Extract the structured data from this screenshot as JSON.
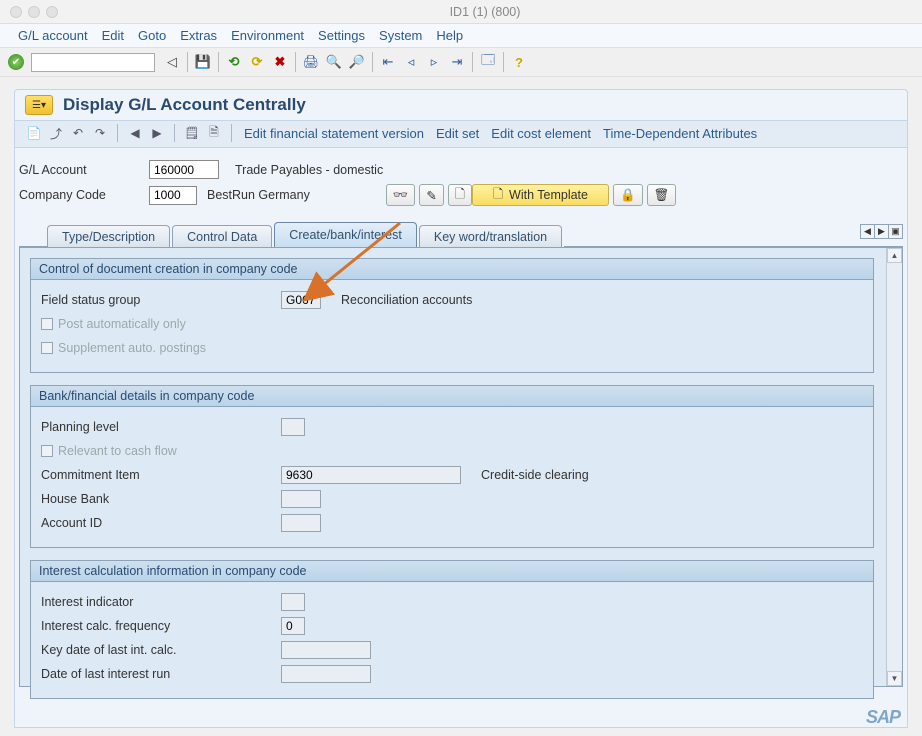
{
  "window": {
    "title": "ID1 (1) (800)"
  },
  "menu": {
    "items": [
      "G/L account",
      "Edit",
      "Goto",
      "Extras",
      "Environment",
      "Settings",
      "System",
      "Help"
    ]
  },
  "page": {
    "title": "Display G/L Account Centrally"
  },
  "actions": {
    "editFin": "Edit financial statement version",
    "editSet": "Edit set",
    "editCost": "Edit cost element",
    "timeDep": "Time-Dependent Attributes"
  },
  "ident": {
    "glaccount_label": "G/L Account",
    "glaccount_value": "160000",
    "glaccount_desc": "Trade Payables - domestic",
    "cocode_label": "Company Code",
    "cocode_value": "1000",
    "cocode_desc": "BestRun Germany",
    "withTemplate": "With Template"
  },
  "tabs": {
    "t1": "Type/Description",
    "t2": "Control Data",
    "t3": "Create/bank/interest",
    "t4": "Key word/translation"
  },
  "g1": {
    "head": "Control of document creation in company code",
    "fsg_label": "Field status group",
    "fsg_value": "G067",
    "fsg_desc": "Reconciliation accounts",
    "postauto_label": "Post automatically only",
    "supauto_label": "Supplement auto. postings"
  },
  "g2": {
    "head": "Bank/financial details in company code",
    "plan_label": "Planning level",
    "cashflow_label": "Relevant to cash flow",
    "commitem_label": "Commitment Item",
    "commitem_value": "9630",
    "commitem_desc": "Credit-side clearing",
    "housebank_label": "House Bank",
    "acctid_label": "Account ID"
  },
  "g3": {
    "head": "Interest calculation information in company code",
    "intind_label": "Interest indicator",
    "intfreq_label": "Interest calc. frequency",
    "intfreq_value": "0",
    "keydate_label": "Key date of last int. calc.",
    "lastrun_label": "Date of last interest run"
  },
  "sap": "SAP"
}
